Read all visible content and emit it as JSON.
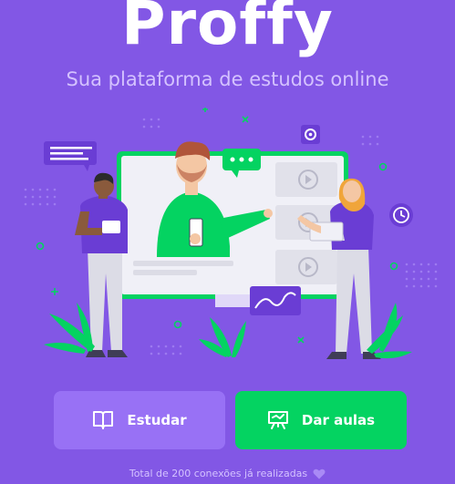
{
  "app": {
    "logo_text": "Proffy",
    "tagline": "Sua plataforma de estudos online"
  },
  "buttons": {
    "study_label": "Estudar",
    "study_icon": "book-open-icon",
    "teach_label": "Dar aulas",
    "teach_icon": "presentation-board-icon"
  },
  "footer": {
    "connections_text": "Total de 200 conexões já realizadas",
    "heart_icon": "purple-heart-icon"
  },
  "colors": {
    "background": "#8257e5",
    "study_button": "#9871f5",
    "teach_button": "#04d361",
    "text_light": "#d4c2ff"
  }
}
